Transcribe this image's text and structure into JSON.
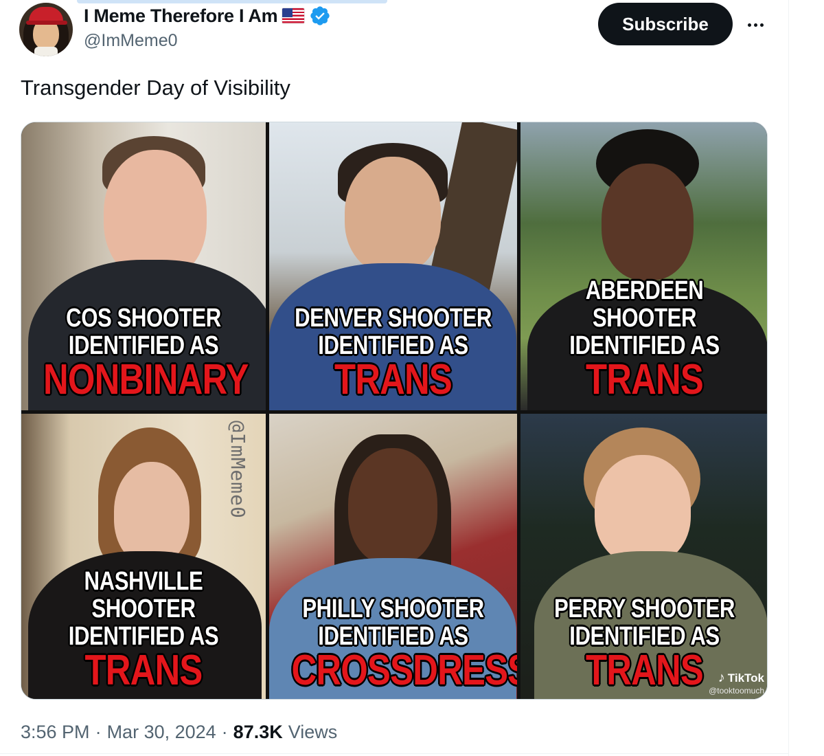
{
  "tweet": {
    "author": {
      "display_name": "I Meme Therefore I Am",
      "flag_icon": "us-flag-icon",
      "verified_icon": "verified-badge-icon",
      "handle": "@ImMeme0"
    },
    "subscribe_label": "Subscribe",
    "more_icon": "more-horizontal-icon",
    "text": "Transgender Day of Visibility",
    "meta": {
      "time": "3:56 PM",
      "sep1": "·",
      "date": "Mar 30, 2024",
      "sep2": "·",
      "views_count": "87.3K",
      "views_label": "Views"
    }
  },
  "media": {
    "panels": [
      {
        "line1": "COS SHOOTER",
        "line2": "IDENTIFIED AS",
        "line3": "NONBINARY"
      },
      {
        "line1": "DENVER SHOOTER",
        "line2": "IDENTIFIED AS",
        "line3": "TRANS"
      },
      {
        "line1": "ABERDEEN SHOOTER",
        "line2": "IDENTIFIED AS",
        "line3": "TRANS"
      },
      {
        "line1": "NASHVILLE SHOOTER",
        "line2": "IDENTIFIED AS",
        "line3": "TRANS"
      },
      {
        "line1": "PHILLY SHOOTER",
        "line2": "IDENTIFIED AS",
        "line3": "CROSSDRESSER"
      },
      {
        "line1": "PERRY SHOOTER",
        "line2": "IDENTIFIED AS",
        "line3": "TRANS"
      }
    ],
    "watermark": "@ImMeme0",
    "tiktok_brand": "TikTok",
    "tiktok_user": "@tooktoomuch"
  },
  "colors": {
    "caption_red": "#e3161b",
    "subscribe_bg": "#0f1419",
    "verified_blue": "#1d9bf0",
    "secondary_text": "#536471"
  }
}
